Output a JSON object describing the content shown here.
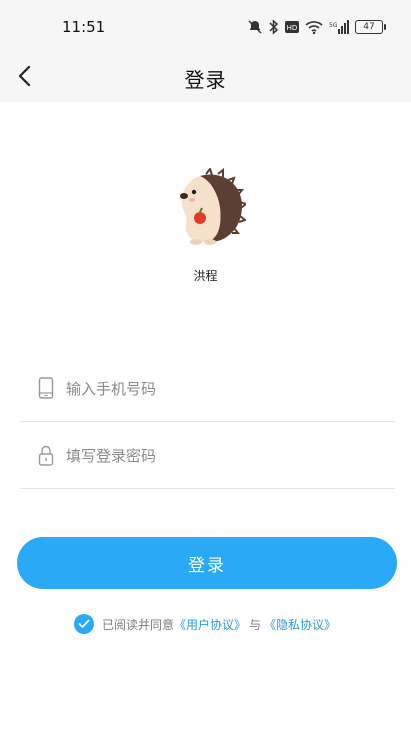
{
  "status_bar": {
    "time": "11:51",
    "battery": "47",
    "icons": [
      "mute-bell-icon",
      "bluetooth-icon",
      "hd-icon",
      "wifi-icon",
      "signal-5g-icon",
      "battery-icon"
    ]
  },
  "nav": {
    "title": "登录",
    "back_icon": "chevron-left-icon"
  },
  "app": {
    "name": "洪程",
    "logo": "hedgehog-mascot"
  },
  "form": {
    "phone_placeholder": "输入手机号码",
    "password_placeholder": "填写登录密码",
    "login_label": "登录"
  },
  "agreement": {
    "checked": true,
    "prefix": "已阅读并同意",
    "user_agreement": "《用户协议》",
    "conjunction": "与",
    "privacy_agreement": "《隐私协议》"
  },
  "colors": {
    "accent": "#2aa9f6",
    "link": "#2a9be0",
    "header_bg": "#f6f6f6"
  }
}
